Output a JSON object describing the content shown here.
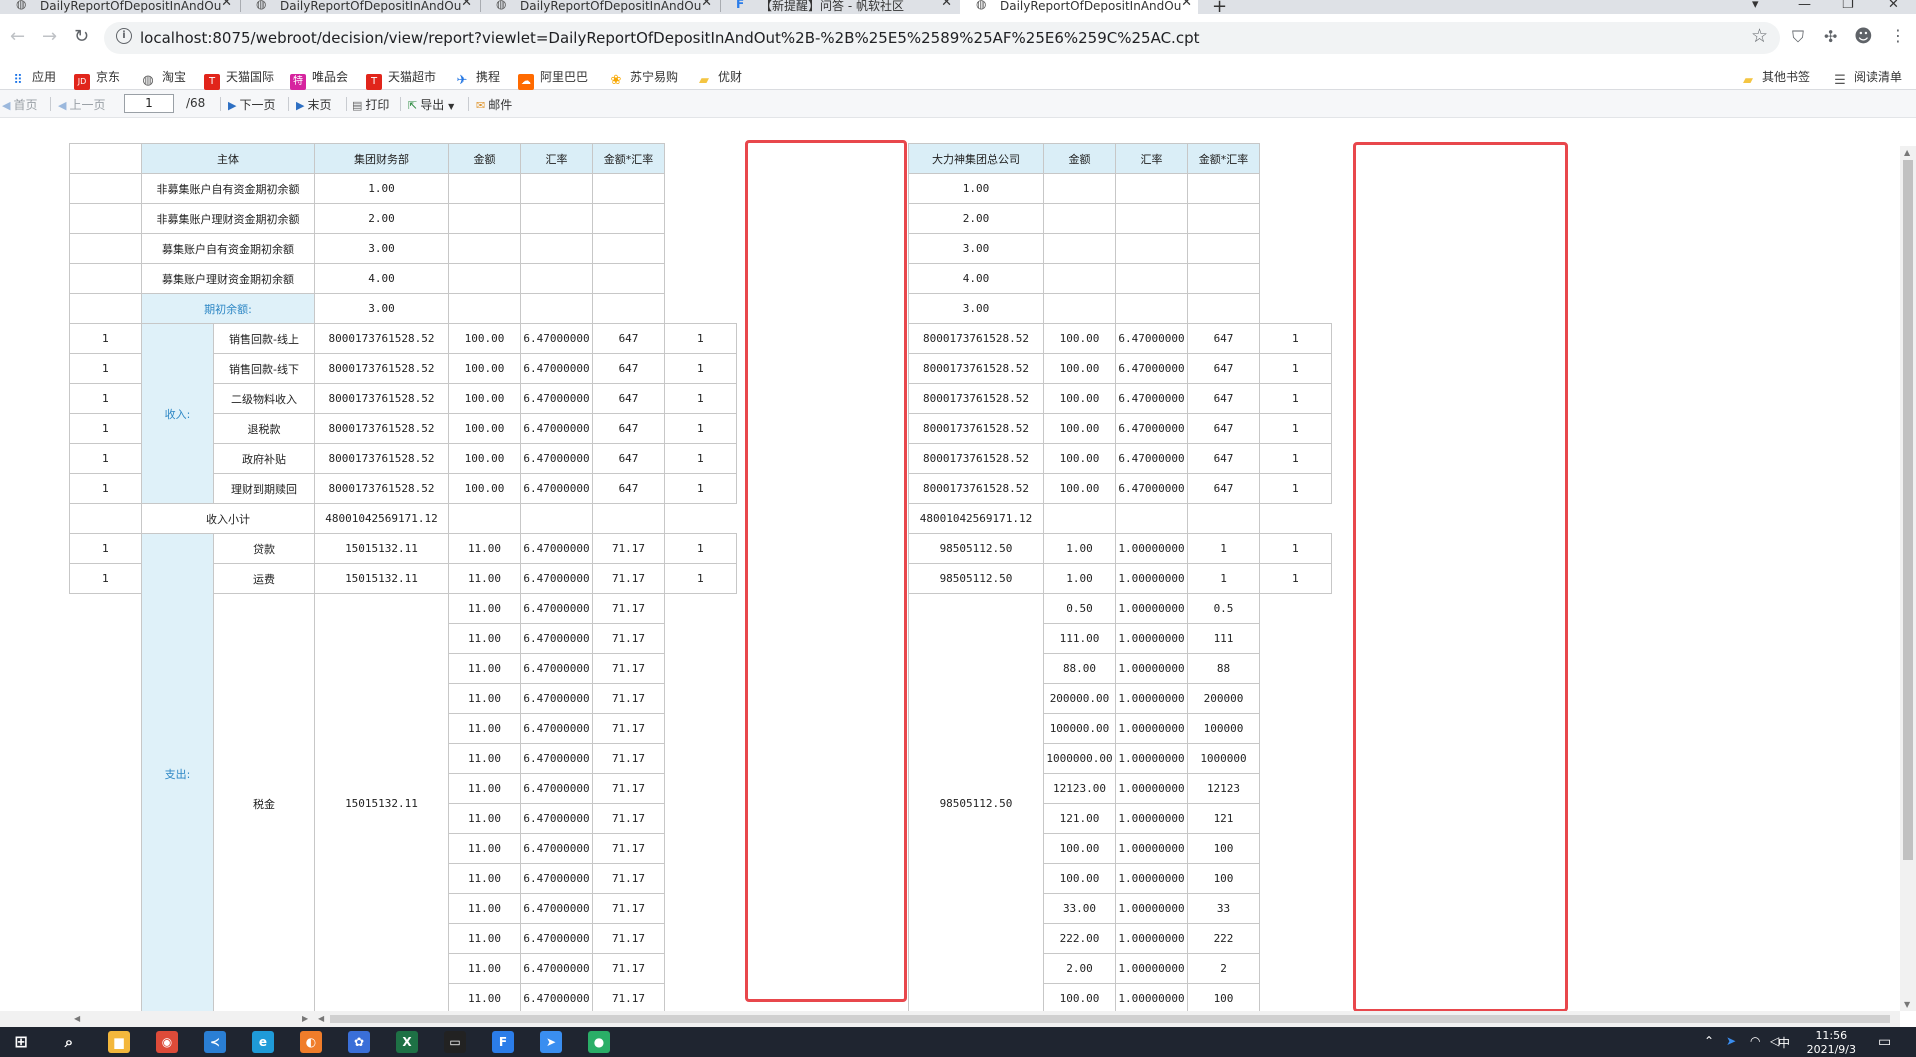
{
  "browser": {
    "tabs": [
      {
        "title": "DailyReportOfDepositInAndOu",
        "active": false
      },
      {
        "title": "DailyReportOfDepositInAndOu",
        "active": false
      },
      {
        "title": "DailyReportOfDepositInAndOu",
        "active": false
      },
      {
        "title": "【新提醒】问答 - 帆软社区",
        "active": false
      },
      {
        "title": "DailyReportOfDepositInAndOu",
        "active": true
      }
    ],
    "url": "localhost:8075/webroot/decision/view/report?viewlet=DailyReportOfDepositInAndOut%2B-%2B%25E5%2589%25AF%25E6%259C%25AC.cpt",
    "bookmarks": [
      {
        "label": "应用",
        "color": "#1a73e8"
      },
      {
        "label": "京东",
        "color": "#e1251b",
        "badge": "JD"
      },
      {
        "label": "淘宝",
        "color": "#555555"
      },
      {
        "label": "天猫国际",
        "color": "#e1251b",
        "badge": "T"
      },
      {
        "label": "唯品会",
        "color": "#d6249f",
        "badge": "特"
      },
      {
        "label": "天猫超市",
        "color": "#e1251b",
        "badge": "T"
      },
      {
        "label": "携程",
        "color": "#2577e3"
      },
      {
        "label": "阿里巴巴",
        "color": "#ff6a00"
      },
      {
        "label": "苏宁易购",
        "color": "#f7a700"
      },
      {
        "label": "优财",
        "color": "#f4c542"
      }
    ],
    "bookmarks_right": [
      {
        "label": "其他书签"
      },
      {
        "label": "阅读清单"
      }
    ]
  },
  "toolbar": {
    "first": "首页",
    "prev": "上一页",
    "page_value": "1",
    "total": "/68",
    "next": "下一页",
    "last": "末页",
    "print": "打印",
    "export": "导出",
    "mail": "邮件"
  },
  "report": {
    "left": {
      "headers": [
        "主体",
        "集团财务部",
        "金额",
        "汇率",
        "金额*汇率"
      ],
      "opening_items": [
        {
          "label": "非募集账户自有资金期初余额",
          "value": "1.00"
        },
        {
          "label": "非募集账户理财资金期初余额",
          "value": "2.00"
        },
        {
          "label": "募集账户自有资金期初余额",
          "value": "3.00"
        },
        {
          "label": "募集账户理财资金期初余额",
          "value": "4.00"
        }
      ],
      "opening_total": {
        "label": "期初余额:",
        "value": "3.00"
      },
      "income_group": "收入:",
      "income_rows": [
        {
          "idx": "1",
          "item": "销售回款-线上",
          "value": "8000173761528.52",
          "amount": "100.00",
          "rate": "6.47000000",
          "product": "647",
          "flag": "1"
        },
        {
          "idx": "1",
          "item": "销售回款-线下",
          "value": "8000173761528.52",
          "amount": "100.00",
          "rate": "6.47000000",
          "product": "647",
          "flag": "1"
        },
        {
          "idx": "1",
          "item": "二级物料收入",
          "value": "8000173761528.52",
          "amount": "100.00",
          "rate": "6.47000000",
          "product": "647",
          "flag": "1"
        },
        {
          "idx": "1",
          "item": "退税款",
          "value": "8000173761528.52",
          "amount": "100.00",
          "rate": "6.47000000",
          "product": "647",
          "flag": "1"
        },
        {
          "idx": "1",
          "item": "政府补贴",
          "value": "8000173761528.52",
          "amount": "100.00",
          "rate": "6.47000000",
          "product": "647",
          "flag": "1"
        },
        {
          "idx": "1",
          "item": "理财到期赎回",
          "value": "8000173761528.52",
          "amount": "100.00",
          "rate": "6.47000000",
          "product": "647",
          "flag": "1"
        }
      ],
      "income_subtotal": {
        "label": "收入小计",
        "value": "48001042569171.12"
      },
      "expense_group": "支出:",
      "expense_rows": [
        {
          "idx": "1",
          "item": "贷款",
          "value": "15015132.11",
          "amount": "11.00",
          "rate": "6.47000000",
          "product": "71.17",
          "flag": "1"
        },
        {
          "idx": "1",
          "item": "运费",
          "value": "15015132.11",
          "amount": "11.00",
          "rate": "6.47000000",
          "product": "71.17",
          "flag": "1"
        }
      ],
      "tax": {
        "item": "税金",
        "value": "15015132.11",
        "rows": [
          {
            "amount": "11.00",
            "rate": "6.47000000",
            "product": "71.17"
          },
          {
            "amount": "11.00",
            "rate": "6.47000000",
            "product": "71.17"
          },
          {
            "amount": "11.00",
            "rate": "6.47000000",
            "product": "71.17"
          },
          {
            "amount": "11.00",
            "rate": "6.47000000",
            "product": "71.17"
          },
          {
            "amount": "11.00",
            "rate": "6.47000000",
            "product": "71.17"
          },
          {
            "amount": "11.00",
            "rate": "6.47000000",
            "product": "71.17"
          },
          {
            "amount": "11.00",
            "rate": "6.47000000",
            "product": "71.17"
          },
          {
            "amount": "11.00",
            "rate": "6.47000000",
            "product": "71.17"
          },
          {
            "amount": "11.00",
            "rate": "6.47000000",
            "product": "71.17"
          },
          {
            "amount": "11.00",
            "rate": "6.47000000",
            "product": "71.17"
          },
          {
            "amount": "11.00",
            "rate": "6.47000000",
            "product": "71.17"
          },
          {
            "amount": "11.00",
            "rate": "6.47000000",
            "product": "71.17"
          },
          {
            "amount": "11.00",
            "rate": "6.47000000",
            "product": "71.17"
          },
          {
            "amount": "11.00",
            "rate": "6.47000000",
            "product": "71.17"
          }
        ]
      }
    },
    "right": {
      "headers": [
        "大力神集团总公司",
        "金额",
        "汇率",
        "金额*汇率"
      ],
      "opening_values": [
        "1.00",
        "2.00",
        "3.00",
        "4.00",
        "3.00"
      ],
      "income_rows": [
        {
          "value": "8000173761528.52",
          "amount": "100.00",
          "rate": "6.47000000",
          "product": "647",
          "flag": "1"
        },
        {
          "value": "8000173761528.52",
          "amount": "100.00",
          "rate": "6.47000000",
          "product": "647",
          "flag": "1"
        },
        {
          "value": "8000173761528.52",
          "amount": "100.00",
          "rate": "6.47000000",
          "product": "647",
          "flag": "1"
        },
        {
          "value": "8000173761528.52",
          "amount": "100.00",
          "rate": "6.47000000",
          "product": "647",
          "flag": "1"
        },
        {
          "value": "8000173761528.52",
          "amount": "100.00",
          "rate": "6.47000000",
          "product": "647",
          "flag": "1"
        },
        {
          "value": "8000173761528.52",
          "amount": "100.00",
          "rate": "6.47000000",
          "product": "647",
          "flag": "1"
        }
      ],
      "income_subtotal": "48001042569171.12",
      "expense_rows": [
        {
          "value": "98505112.50",
          "amount": "1.00",
          "rate": "1.00000000",
          "product": "1",
          "flag": "1"
        },
        {
          "value": "98505112.50",
          "amount": "1.00",
          "rate": "1.00000000",
          "product": "1",
          "flag": "1"
        }
      ],
      "tax": {
        "value": "98505112.50",
        "rows": [
          {
            "amount": "0.50",
            "rate": "1.00000000",
            "product": "0.5"
          },
          {
            "amount": "111.00",
            "rate": "1.00000000",
            "product": "111"
          },
          {
            "amount": "88.00",
            "rate": "1.00000000",
            "product": "88"
          },
          {
            "amount": "200000.00",
            "rate": "1.00000000",
            "product": "200000"
          },
          {
            "amount": "100000.00",
            "rate": "1.00000000",
            "product": "100000"
          },
          {
            "amount": "1000000.00",
            "rate": "1.00000000",
            "product": "1000000"
          },
          {
            "amount": "12123.00",
            "rate": "1.00000000",
            "product": "12123"
          },
          {
            "amount": "121.00",
            "rate": "1.00000000",
            "product": "121"
          },
          {
            "amount": "100.00",
            "rate": "1.00000000",
            "product": "100"
          },
          {
            "amount": "100.00",
            "rate": "1.00000000",
            "product": "100"
          },
          {
            "amount": "33.00",
            "rate": "1.00000000",
            "product": "33"
          },
          {
            "amount": "222.00",
            "rate": "1.00000000",
            "product": "222"
          },
          {
            "amount": "2.00",
            "rate": "1.00000000",
            "product": "2"
          },
          {
            "amount": "100.00",
            "rate": "1.00000000",
            "product": "100"
          }
        ]
      }
    },
    "highlight_color": "#e8474c"
  },
  "taskbar": {
    "apps": [
      {
        "name": "file-explorer",
        "color": "#f3b73c",
        "glyph": "▆"
      },
      {
        "name": "chrome",
        "color": "#dd4b39",
        "glyph": "◉"
      },
      {
        "name": "vscode",
        "color": "#2a7fd4",
        "glyph": "≺"
      },
      {
        "name": "edge",
        "color": "#1f9bd8",
        "glyph": "e"
      },
      {
        "name": "orange-app",
        "color": "#f07d2a",
        "glyph": "◐"
      },
      {
        "name": "photo-app",
        "color": "#3a6fd8",
        "glyph": "✿"
      },
      {
        "name": "excel",
        "color": "#1e7145",
        "glyph": "X"
      },
      {
        "name": "terminal",
        "color": "#222222",
        "glyph": "▭"
      },
      {
        "name": "finereport",
        "color": "#2b7de9",
        "glyph": "F"
      },
      {
        "name": "feishu",
        "color": "#3a8ef0",
        "glyph": "➤"
      },
      {
        "name": "wechat",
        "color": "#2aae67",
        "glyph": "●"
      }
    ],
    "time": "11:56",
    "date": "2021/9/3",
    "ime": "中"
  }
}
